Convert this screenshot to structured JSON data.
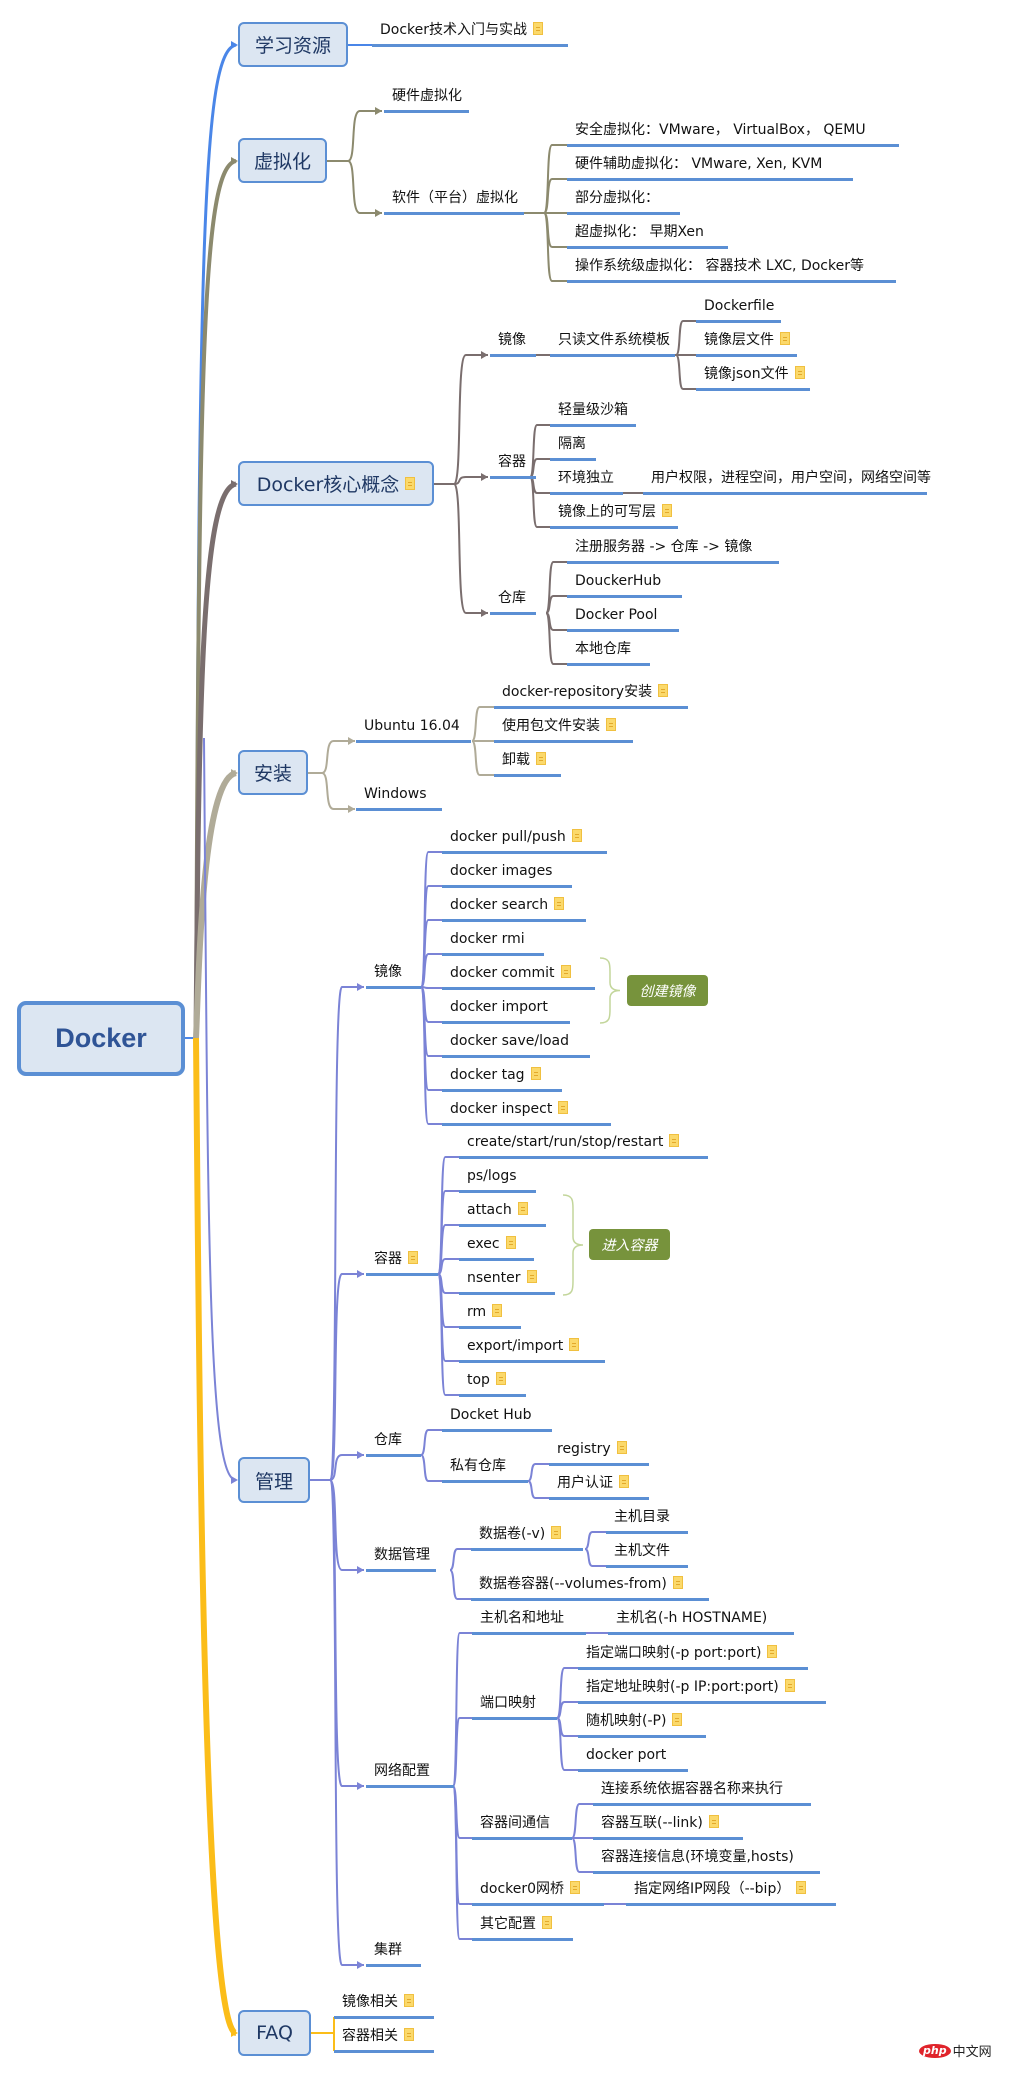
{
  "root": {
    "label": "Docker"
  },
  "colors": {
    "box_fill": "#dce6f2",
    "box_border": "#5b8fd4",
    "underline": "#5b8fd4",
    "branch_learning": "#4a86e8",
    "branch_virtualization": "#8c8a6e",
    "branch_core": "#7a6e6e",
    "branch_install": "#b0ab98",
    "branch_manage": "#7b83d6",
    "branch_faq": "#fbbd19",
    "tag_fill": "#77933c",
    "note_icon": "#fbd96b"
  },
  "topics": {
    "learning": {
      "label": "学习资源",
      "children": [
        {
          "label": "Docker技术入门与实战",
          "note": true
        }
      ]
    },
    "virtualization": {
      "label": "虚拟化",
      "children": [
        {
          "label": "硬件虚拟化"
        },
        {
          "label": "软件（平台）虚拟化",
          "children": [
            {
              "label": "安全虚拟化：VMware， VirtualBox， QEMU"
            },
            {
              "label": "硬件辅助虚拟化： VMware, Xen, KVM"
            },
            {
              "label": "部分虚拟化："
            },
            {
              "label": "超虚拟化： 早期Xen"
            },
            {
              "label": "操作系统级虚拟化： 容器技术 LXC, Docker等"
            }
          ]
        }
      ]
    },
    "core": {
      "label": "Docker核心概念",
      "note": true,
      "children": [
        {
          "label": "镜像",
          "children": [
            {
              "label": "只读文件系统模板",
              "children": [
                {
                  "label": "Dockerfile"
                },
                {
                  "label": "镜像层文件",
                  "note": true
                },
                {
                  "label": "镜像json文件",
                  "note": true
                }
              ]
            }
          ]
        },
        {
          "label": "容器",
          "children": [
            {
              "label": "轻量级沙箱"
            },
            {
              "label": "隔离"
            },
            {
              "label": "环境独立",
              "children": [
                {
                  "label": "用户权限，进程空间，用户空间，网络空间等"
                }
              ]
            },
            {
              "label": "镜像上的可写层",
              "note": true
            }
          ]
        },
        {
          "label": "仓库",
          "children": [
            {
              "label": "注册服务器  -> 仓库 -> 镜像"
            },
            {
              "label": "DouckerHub"
            },
            {
              "label": "Docker Pool"
            },
            {
              "label": "本地仓库"
            }
          ]
        }
      ]
    },
    "install": {
      "label": "安装",
      "children": [
        {
          "label": "Ubuntu 16.04",
          "children": [
            {
              "label": "docker-repository安装",
              "note": true
            },
            {
              "label": "使用包文件安装",
              "note": true
            },
            {
              "label": "卸载",
              "note": true
            }
          ]
        },
        {
          "label": "Windows"
        }
      ]
    },
    "manage": {
      "label": "管理",
      "children": [
        {
          "label": "镜像",
          "children": [
            {
              "label": "docker pull/push",
              "note": true
            },
            {
              "label": "docker images"
            },
            {
              "label": "docker search",
              "note": true
            },
            {
              "label": "docker rmi"
            },
            {
              "label": "docker commit",
              "note": true
            },
            {
              "label": "docker import"
            },
            {
              "label": "docker save/load"
            },
            {
              "label": "docker tag",
              "note": true
            },
            {
              "label": "docker inspect",
              "note": true
            }
          ],
          "summary": "创建镜像"
        },
        {
          "label": "容器",
          "note": true,
          "children": [
            {
              "label": "create/start/run/stop/restart",
              "note": true
            },
            {
              "label": "ps/logs"
            },
            {
              "label": "attach",
              "note": true
            },
            {
              "label": "exec",
              "note": true
            },
            {
              "label": "nsenter",
              "note": true
            },
            {
              "label": "rm",
              "note": true
            },
            {
              "label": "export/import",
              "note": true
            },
            {
              "label": "top",
              "note": true
            }
          ],
          "summary": "进入容器"
        },
        {
          "label": "仓库",
          "children": [
            {
              "label": "Docket Hub"
            },
            {
              "label": "私有仓库",
              "children": [
                {
                  "label": "registry",
                  "note": true
                },
                {
                  "label": "用户认证",
                  "note": true
                }
              ]
            }
          ]
        },
        {
          "label": "数据管理",
          "children": [
            {
              "label": "数据卷(-v)",
              "note": true,
              "children": [
                {
                  "label": "主机目录"
                },
                {
                  "label": "主机文件"
                }
              ]
            },
            {
              "label": "数据卷容器(--volumes-from)",
              "note": true
            }
          ]
        },
        {
          "label": "网络配置",
          "children": [
            {
              "label": "主机名和地址",
              "children": [
                {
                  "label": "主机名(-h HOSTNAME)"
                }
              ]
            },
            {
              "label": "端口映射",
              "children": [
                {
                  "label": "指定端口映射(-p port:port)",
                  "note": true
                },
                {
                  "label": "指定地址映射(-p IP:port:port)",
                  "note": true
                },
                {
                  "label": "随机映射(-P)",
                  "note": true
                },
                {
                  "label": "docker port"
                }
              ]
            },
            {
              "label": "容器间通信",
              "children": [
                {
                  "label": "连接系统依据容器名称来执行"
                },
                {
                  "label": "容器互联(--link)",
                  "note": true
                },
                {
                  "label": "容器连接信息(环境变量,hosts)"
                }
              ]
            },
            {
              "label": "docker0网桥",
              "note": true,
              "children": [
                {
                  "label": "指定网络IP网段（--bip）",
                  "note": true
                }
              ]
            },
            {
              "label": "其它配置",
              "note": true
            }
          ]
        },
        {
          "label": "集群"
        }
      ]
    },
    "faq": {
      "label": "FAQ",
      "children": [
        {
          "label": "镜像相关",
          "note": true
        },
        {
          "label": "容器相关",
          "note": true
        }
      ]
    }
  },
  "watermark": {
    "badge": "php",
    "text": "中文网"
  }
}
